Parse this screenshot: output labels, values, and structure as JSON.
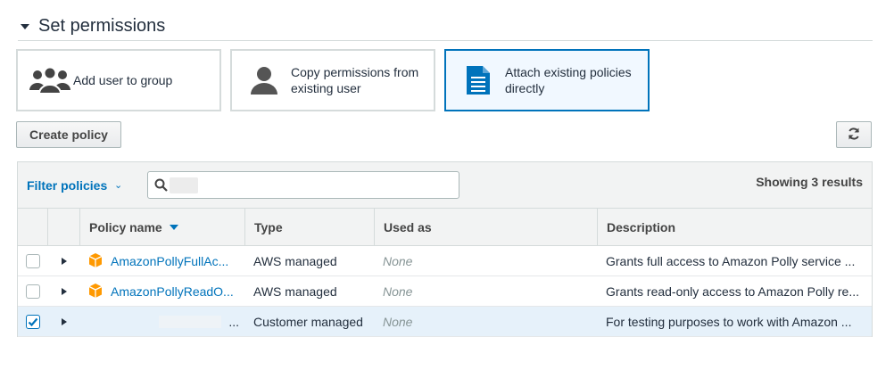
{
  "section": {
    "title": "Set permissions"
  },
  "options": [
    {
      "label_line1": "Add user to group",
      "label_line2": "",
      "icon": "group-icon"
    },
    {
      "label_line1": "Copy permissions from",
      "label_line2": "existing user",
      "icon": "user-icon"
    },
    {
      "label_line1": "Attach existing policies",
      "label_line2": "directly",
      "icon": "document-icon",
      "selected": true
    }
  ],
  "toolbar": {
    "create_policy": "Create policy",
    "refresh_icon": "refresh-icon"
  },
  "filter": {
    "label": "Filter policies",
    "search_value": "",
    "results_text": "Showing 3 results"
  },
  "table": {
    "headers": {
      "policy_name": "Policy name",
      "type": "Type",
      "used_as": "Used as",
      "description": "Description"
    },
    "rows": [
      {
        "checked": false,
        "name": "AmazonPollyFullAc...",
        "type": "AWS managed",
        "used_as": "None",
        "description": "Grants full access to Amazon Polly service ...",
        "icon": "aws-box-icon"
      },
      {
        "checked": false,
        "name": "AmazonPollyReadO...",
        "type": "AWS managed",
        "used_as": "None",
        "description": "Grants read-only access to Amazon Polly re...",
        "icon": "aws-box-icon"
      },
      {
        "checked": true,
        "name": "...",
        "type": "Customer managed",
        "used_as": "None",
        "description": "For testing purposes to work with Amazon ...",
        "icon": ""
      }
    ]
  },
  "colors": {
    "accent": "#0073bb",
    "selected_bg": "#f1f8ff",
    "aws_orange": "#f90"
  }
}
